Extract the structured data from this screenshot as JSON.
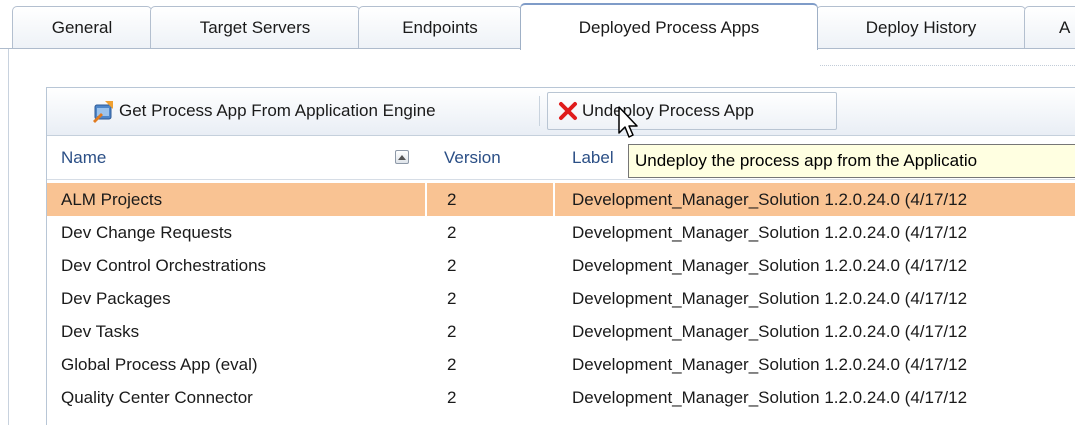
{
  "tabs": [
    {
      "label": "General",
      "active": false
    },
    {
      "label": "Target Servers",
      "active": false
    },
    {
      "label": "Endpoints",
      "active": false
    },
    {
      "label": "Deployed Process Apps",
      "active": true
    },
    {
      "label": "Deploy History",
      "active": false
    },
    {
      "label": "A",
      "active": false
    }
  ],
  "toolbar": {
    "get_app_label": "Get Process App From Application Engine",
    "get_app_icon": "import-app-icon",
    "undeploy_label": "Undeploy Process App",
    "undeploy_icon": "red-x-icon"
  },
  "table": {
    "columns": [
      "Name",
      "Version",
      "Label"
    ],
    "sort_icon": "sort-ascending-icon",
    "rows": [
      {
        "name": "ALM Projects",
        "version": "2",
        "label": "Development_Manager_Solution 1.2.0.24.0 (4/17/12",
        "selected": true
      },
      {
        "name": "Dev Change Requests",
        "version": "2",
        "label": "Development_Manager_Solution 1.2.0.24.0 (4/17/12",
        "selected": false
      },
      {
        "name": "Dev Control Orchestrations",
        "version": "2",
        "label": "Development_Manager_Solution 1.2.0.24.0 (4/17/12",
        "selected": false
      },
      {
        "name": "Dev Packages",
        "version": "2",
        "label": "Development_Manager_Solution 1.2.0.24.0 (4/17/12",
        "selected": false
      },
      {
        "name": "Dev Tasks",
        "version": "2",
        "label": "Development_Manager_Solution 1.2.0.24.0 (4/17/12",
        "selected": false
      },
      {
        "name": "Global Process App (eval)",
        "version": "2",
        "label": "Development_Manager_Solution 1.2.0.24.0 (4/17/12",
        "selected": false
      },
      {
        "name": "Quality Center Connector",
        "version": "2",
        "label": "Development_Manager_Solution 1.2.0.24.0 (4/17/12",
        "selected": false
      }
    ]
  },
  "tooltip": "Undeploy the process app from the Applicatio",
  "colors": {
    "selected_row": "#f9c393",
    "header_text": "#2b4f86",
    "tooltip_bg": "#ffffe1"
  }
}
